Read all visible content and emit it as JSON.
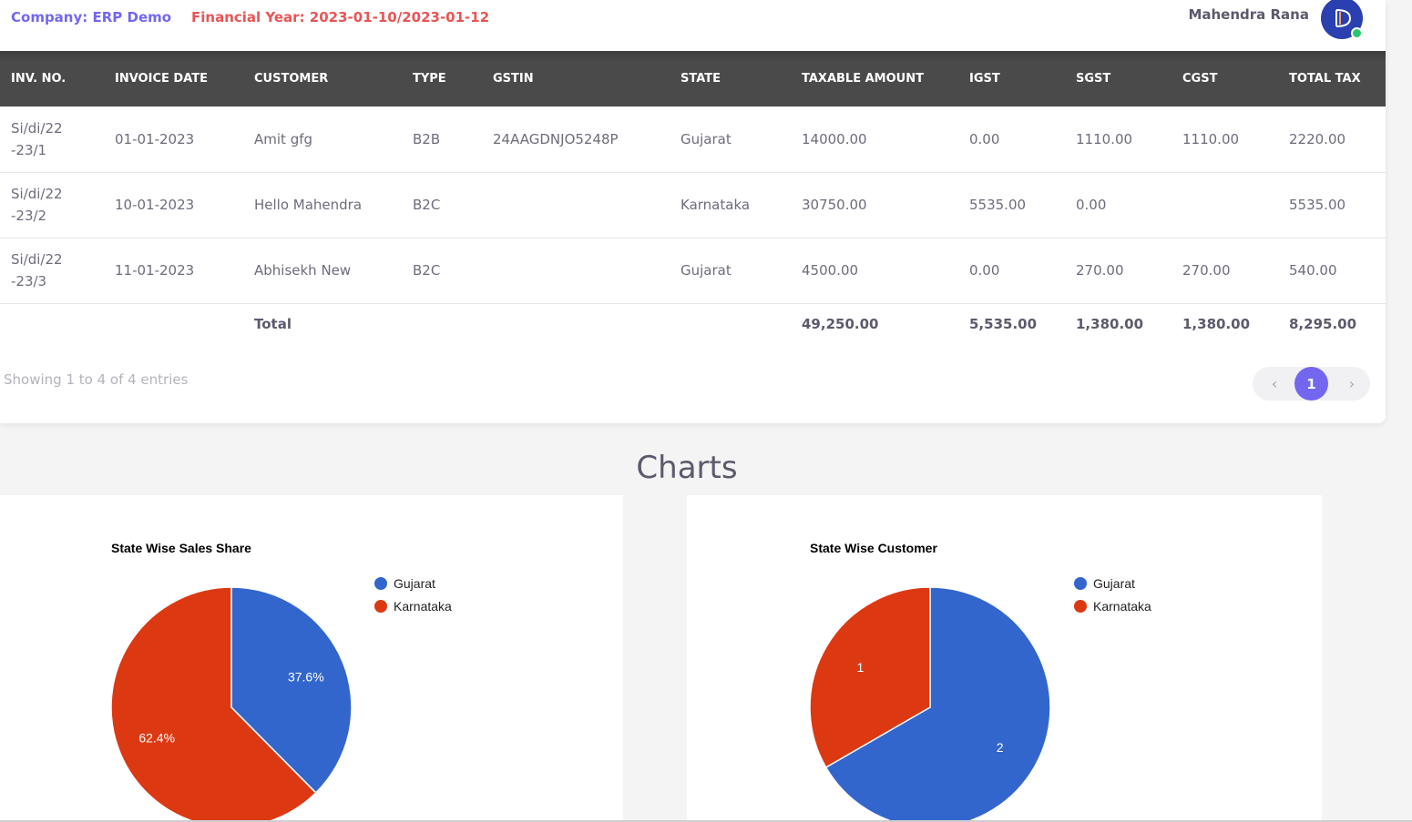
{
  "header": {
    "company": "Company: ERP Demo",
    "financial_year": "Financial Year: 2023-01-10/2023-01-12",
    "user_name": "Mahendra Rana"
  },
  "table": {
    "columns": [
      "INV. NO.",
      "INVOICE DATE",
      "CUSTOMER",
      "TYPE",
      "GSTIN",
      "STATE",
      "TAXABLE AMOUNT",
      "IGST",
      "SGST",
      "CGST",
      "TOTAL TAX"
    ],
    "rows": [
      [
        "Si/di/22-23/1",
        "01-01-2023",
        "Amit gfg",
        "B2B",
        "24AAGDNJO5248P",
        "Gujarat",
        "14000.00",
        "0.00",
        "1110.00",
        "1110.00",
        "2220.00"
      ],
      [
        "Si/di/22-23/2",
        "10-01-2023",
        "Hello Mahendra",
        "B2C",
        "",
        "Karnataka",
        "30750.00",
        "5535.00",
        "0.00",
        "",
        "5535.00"
      ],
      [
        "Si/di/22-23/3",
        "11-01-2023",
        "Abhisekh New",
        "B2C",
        "",
        "Gujarat",
        "4500.00",
        "0.00",
        "270.00",
        "270.00",
        "540.00"
      ]
    ],
    "total": {
      "label": "Total",
      "taxable_amount": "49,250.00",
      "igst": "5,535.00",
      "sgst": "1,380.00",
      "cgst": "1,380.00",
      "total_tax": "8,295.00"
    }
  },
  "footer": {
    "showing": "Showing 1 to 4 of 4 entries",
    "prev": "‹",
    "current_page": "1",
    "next": "›"
  },
  "charts_heading": "Charts",
  "colors": {
    "gujarat": "#3366cc",
    "karnataka": "#dc3912",
    "accent": "#7367f0",
    "danger": "#ea5455"
  },
  "chart_data": [
    {
      "type": "pie",
      "title": "State Wise Sales Share",
      "categories": [
        "Gujarat",
        "Karnataka"
      ],
      "values": [
        37.6,
        62.4
      ],
      "labels": [
        "37.6%",
        "62.4%"
      ],
      "legend": "right"
    },
    {
      "type": "pie",
      "title": "State Wise Customer",
      "categories": [
        "Gujarat",
        "Karnataka"
      ],
      "values": [
        2,
        1
      ],
      "labels": [
        "2",
        "1"
      ],
      "legend": "right"
    }
  ]
}
